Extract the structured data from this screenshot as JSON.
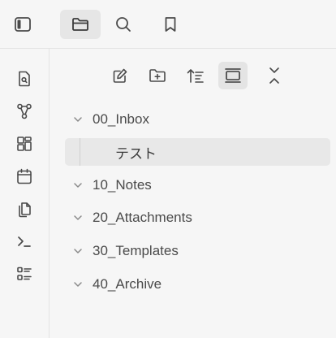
{
  "topbar": {
    "tabs": [
      {
        "name": "sidebar-toggle",
        "icon": "sidebar-toggle-icon"
      },
      {
        "name": "files",
        "icon": "folder-icon",
        "active": true
      },
      {
        "name": "search",
        "icon": "search-icon"
      },
      {
        "name": "bookmarks",
        "icon": "bookmark-icon"
      }
    ]
  },
  "ribbon": {
    "icons": [
      "open-quick-switcher-icon",
      "graph-view-icon",
      "canvas-icon",
      "daily-note-calendar-icon",
      "templates-copy-icon",
      "command-palette-icon",
      "outline-list-icon"
    ]
  },
  "explorer": {
    "toolbar": [
      "new-note-icon",
      "new-folder-icon",
      "sort-order-icon",
      "auto-reveal-icon",
      "collapse-all-icon"
    ],
    "items": [
      {
        "type": "folder",
        "label": "00_Inbox",
        "expanded": true
      },
      {
        "type": "file",
        "label": "テスト",
        "selected": true
      },
      {
        "type": "folder",
        "label": "10_Notes"
      },
      {
        "type": "folder",
        "label": "20_Attachments"
      },
      {
        "type": "folder",
        "label": "30_Templates"
      },
      {
        "type": "folder",
        "label": "40_Archive"
      }
    ]
  },
  "colors": {
    "background": "#f6f6f6",
    "active_tab": "#e6e6e6",
    "selected_row": "#e8e8e8",
    "icon": "#5a5a5a"
  }
}
